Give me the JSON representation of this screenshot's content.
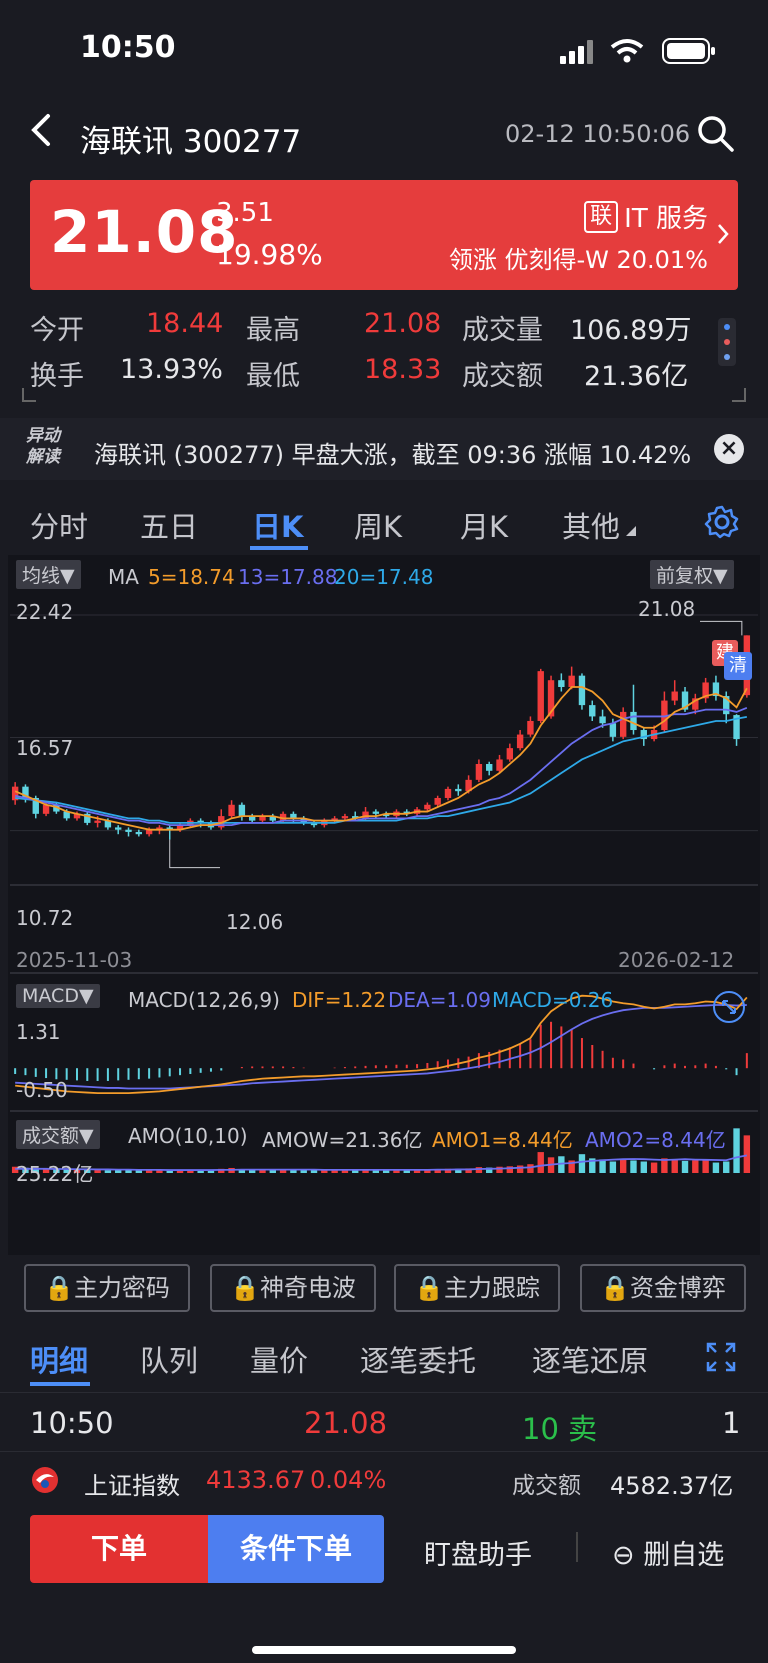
{
  "status": {
    "time": "10:50"
  },
  "header": {
    "title": "海联讯 300277",
    "datetime": "02-12 10:50:06"
  },
  "quote": {
    "price": "21.08",
    "change": "3.51",
    "change_pct": "19.98%",
    "sector_tag": "联",
    "sector": "IT 服务",
    "leader": "领涨 优刻得-W 20.01%"
  },
  "stats": {
    "open_label": "今开",
    "open": "18.44",
    "high_label": "最高",
    "high": "21.08",
    "vol_label": "成交量",
    "vol": "106.89万",
    "turnover_label": "换手",
    "turnover": "13.93%",
    "low_label": "最低",
    "low": "18.33",
    "amt_label": "成交额",
    "amt": "21.36亿"
  },
  "news": {
    "badge_line1": "异动",
    "badge_line2": "解读",
    "text": "海联讯 (300277) 早盘大涨，截至 09:36 涨幅 10.42%",
    "close": "×"
  },
  "tabs": [
    "分时",
    "五日",
    "日K",
    "周K",
    "月K",
    "其他"
  ],
  "chart": {
    "ma_pill": "均线▼",
    "ma_label": "MA",
    "ma5": "5=18.74",
    "ma13": "13=17.88",
    "ma20": "20=17.48",
    "adj_pill": "前复权▼",
    "y_top": "22.42",
    "y_mid": "16.57",
    "y_low": "10.72",
    "high_mark": "21.08",
    "low_mark": "12.06",
    "badge_build": "建",
    "badge_clear": "清",
    "date_start": "2025-11-03",
    "date_end": "2026-02-12",
    "macd_pill": "MACD▼",
    "macd_label": "MACD(12,26,9)",
    "dif": "DIF=1.22",
    "dea": "DEA=1.09",
    "macd": "MACD=0.26",
    "macd_top": "1.31",
    "macd_bottom": "-0.50",
    "amo_pill": "成交额▼",
    "amo_label": "AMO(10,10)",
    "amow": "AMOW=21.36亿",
    "amo1": "AMO1=8.44亿",
    "amo2": "AMO2=8.44亿",
    "amo_top": "25.22亿"
  },
  "func_buttons": [
    "主力密码",
    "神奇电波",
    "主力跟踪",
    "资金博弈"
  ],
  "bottom_tabs": [
    "明细",
    "队列",
    "量价",
    "逐笔委托",
    "逐笔还原"
  ],
  "trade": {
    "time": "10:50",
    "price": "21.08",
    "side": "10 卖",
    "count": "1"
  },
  "index": {
    "name": "上证指数",
    "value": "4133.67",
    "pct": "0.04%",
    "amt_label": "成交额",
    "amt": "4582.37亿"
  },
  "actions": {
    "order": "下单",
    "cond_order": "条件下单",
    "watch": "盯盘助手",
    "remove": "删自选",
    "remove_icon": "⊖"
  },
  "colors": {
    "up": "#f03b3b",
    "down": "#5fd3e0",
    "accent": "#4d8ef7",
    "ma5": "#f39c2b",
    "ma13": "#6a6ef0",
    "ma20": "#2ea9e8"
  },
  "chart_data": {
    "type": "candlestick",
    "ylim": [
      10.72,
      22.42
    ],
    "candles": [
      [
        13.8,
        14.4,
        14.6,
        13.6
      ],
      [
        14.4,
        13.9,
        14.5,
        13.7
      ],
      [
        13.9,
        13.2,
        14.0,
        13.0
      ],
      [
        13.2,
        13.6,
        13.7,
        13.1
      ],
      [
        13.6,
        13.3,
        13.7,
        13.2
      ],
      [
        13.3,
        13.0,
        13.4,
        12.9
      ],
      [
        13.0,
        13.2,
        13.3,
        12.9
      ],
      [
        13.2,
        12.8,
        13.3,
        12.7
      ],
      [
        12.8,
        12.9,
        13.1,
        12.6
      ],
      [
        12.9,
        12.6,
        13.0,
        12.5
      ],
      [
        12.6,
        12.5,
        12.7,
        12.3
      ],
      [
        12.5,
        12.4,
        12.6,
        12.2
      ],
      [
        12.4,
        12.3,
        12.5,
        12.2
      ],
      [
        12.3,
        12.5,
        12.6,
        12.2
      ],
      [
        12.5,
        12.6,
        12.7,
        12.3
      ],
      [
        12.6,
        12.5,
        12.7,
        12.06
      ],
      [
        12.5,
        12.7,
        12.8,
        12.4
      ],
      [
        12.7,
        12.9,
        13.0,
        12.6
      ],
      [
        12.9,
        12.8,
        13.0,
        12.6
      ],
      [
        12.8,
        12.6,
        12.9,
        12.5
      ],
      [
        12.6,
        13.1,
        13.4,
        12.5
      ],
      [
        13.1,
        13.6,
        13.8,
        13.0
      ],
      [
        13.6,
        13.1,
        13.7,
        12.9
      ],
      [
        13.1,
        12.9,
        13.2,
        12.8
      ],
      [
        12.9,
        13.1,
        13.2,
        12.8
      ],
      [
        13.1,
        12.9,
        13.2,
        12.8
      ],
      [
        12.9,
        13.2,
        13.3,
        12.8
      ],
      [
        13.2,
        13.0,
        13.3,
        12.8
      ],
      [
        13.0,
        12.8,
        13.1,
        12.7
      ],
      [
        12.8,
        12.7,
        12.9,
        12.6
      ],
      [
        12.7,
        12.9,
        13.0,
        12.6
      ],
      [
        12.9,
        13.0,
        13.1,
        12.8
      ],
      [
        13.0,
        13.1,
        13.2,
        12.9
      ],
      [
        13.1,
        13.0,
        13.3,
        12.9
      ],
      [
        13.0,
        13.3,
        13.5,
        12.9
      ],
      [
        13.3,
        13.2,
        13.4,
        13.0
      ],
      [
        13.2,
        13.1,
        13.3,
        13.0
      ],
      [
        13.1,
        13.3,
        13.4,
        13.0
      ],
      [
        13.3,
        13.2,
        13.4,
        13.1
      ],
      [
        13.2,
        13.4,
        13.5,
        13.1
      ],
      [
        13.4,
        13.6,
        13.7,
        13.3
      ],
      [
        13.6,
        13.9,
        14.0,
        13.5
      ],
      [
        13.9,
        14.3,
        14.4,
        13.8
      ],
      [
        14.3,
        14.2,
        14.5,
        14.0
      ],
      [
        14.2,
        14.7,
        14.9,
        14.1
      ],
      [
        14.7,
        15.4,
        15.6,
        14.6
      ],
      [
        15.4,
        15.1,
        15.5,
        14.9
      ],
      [
        15.1,
        15.6,
        15.8,
        15.0
      ],
      [
        15.6,
        16.1,
        16.3,
        15.5
      ],
      [
        16.1,
        16.7,
        16.9,
        16.0
      ],
      [
        16.7,
        17.3,
        17.5,
        16.6
      ],
      [
        17.3,
        19.5,
        19.6,
        17.2
      ],
      [
        17.5,
        19.1,
        19.3,
        17.4
      ],
      [
        19.1,
        18.8,
        19.4,
        18.6
      ],
      [
        18.8,
        19.3,
        19.7,
        18.7
      ],
      [
        19.3,
        18.0,
        19.4,
        17.8
      ],
      [
        18.0,
        17.5,
        18.2,
        17.3
      ],
      [
        17.5,
        17.2,
        17.8,
        17.0
      ],
      [
        17.2,
        16.6,
        17.4,
        16.4
      ],
      [
        16.6,
        17.7,
        17.9,
        16.5
      ],
      [
        17.7,
        16.9,
        18.9,
        16.7
      ],
      [
        16.9,
        16.5,
        17.0,
        16.2
      ],
      [
        16.5,
        16.9,
        17.1,
        16.4
      ],
      [
        16.9,
        18.2,
        18.6,
        16.8
      ],
      [
        18.2,
        18.6,
        19.1,
        18.0
      ],
      [
        18.6,
        17.8,
        18.8,
        17.7
      ],
      [
        17.8,
        18.3,
        18.5,
        17.6
      ],
      [
        18.3,
        19.0,
        19.2,
        18.1
      ],
      [
        19.0,
        18.4,
        19.3,
        18.2
      ],
      [
        18.4,
        17.6,
        18.6,
        17.2
      ],
      [
        17.56,
        16.5,
        17.6,
        16.2
      ],
      [
        18.44,
        21.08,
        21.08,
        18.33
      ]
    ],
    "ma5": [
      14.2,
      14.0,
      13.8,
      13.6,
      13.5,
      13.3,
      13.2,
      13.1,
      13.0,
      12.9,
      12.8,
      12.7,
      12.6,
      12.5,
      12.5,
      12.5,
      12.5,
      12.6,
      12.7,
      12.7,
      12.8,
      13.0,
      13.1,
      13.1,
      13.1,
      13.1,
      13.0,
      13.0,
      13.0,
      12.9,
      12.9,
      12.9,
      12.9,
      13.0,
      13.1,
      13.1,
      13.2,
      13.2,
      13.2,
      13.3,
      13.3,
      13.5,
      13.7,
      13.9,
      14.2,
      14.5,
      14.7,
      15.0,
      15.4,
      15.8,
      16.3,
      17.1,
      17.7,
      18.3,
      18.8,
      18.8,
      18.6,
      18.2,
      17.6,
      17.4,
      17.2,
      17.0,
      17.0,
      17.3,
      17.7,
      17.9,
      18.2,
      18.4,
      18.5,
      18.3,
      17.9,
      18.74
    ],
    "ma13": [
      14.0,
      13.9,
      13.8,
      13.7,
      13.6,
      13.5,
      13.4,
      13.3,
      13.2,
      13.1,
      13.0,
      12.9,
      12.9,
      12.8,
      12.8,
      12.7,
      12.7,
      12.7,
      12.7,
      12.7,
      12.7,
      12.7,
      12.8,
      12.8,
      12.8,
      12.8,
      12.9,
      12.9,
      12.9,
      12.9,
      12.9,
      12.9,
      12.9,
      12.9,
      13.0,
      13.0,
      13.0,
      13.0,
      13.0,
      13.1,
      13.1,
      13.2,
      13.3,
      13.4,
      13.5,
      13.6,
      13.8,
      13.9,
      14.1,
      14.4,
      14.7,
      15.1,
      15.5,
      15.9,
      16.3,
      16.6,
      16.9,
      17.1,
      17.2,
      17.4,
      17.5,
      17.5,
      17.5,
      17.5,
      17.6,
      17.6,
      17.7,
      17.8,
      17.8,
      17.8,
      17.7,
      17.88
    ],
    "ma20": [
      13.9,
      13.85,
      13.8,
      13.75,
      13.7,
      13.6,
      13.5,
      13.4,
      13.3,
      13.2,
      13.1,
      13.0,
      13.0,
      12.9,
      12.9,
      12.8,
      12.8,
      12.8,
      12.8,
      12.8,
      12.8,
      12.8,
      12.8,
      12.8,
      12.8,
      12.8,
      12.8,
      12.8,
      12.8,
      12.8,
      12.8,
      12.8,
      12.9,
      12.9,
      12.9,
      12.9,
      12.9,
      12.9,
      13.0,
      13.0,
      13.0,
      13.1,
      13.1,
      13.2,
      13.3,
      13.4,
      13.5,
      13.6,
      13.7,
      13.9,
      14.1,
      14.4,
      14.7,
      15.0,
      15.3,
      15.6,
      15.8,
      16.0,
      16.2,
      16.4,
      16.5,
      16.6,
      16.7,
      16.8,
      16.9,
      17.0,
      17.1,
      17.2,
      17.3,
      17.3,
      17.4,
      17.48
    ],
    "macd": [
      -0.1,
      -0.12,
      -0.15,
      -0.17,
      -0.19,
      -0.2,
      -0.21,
      -0.22,
      -0.22,
      -0.22,
      -0.21,
      -0.2,
      -0.19,
      -0.18,
      -0.16,
      -0.14,
      -0.12,
      -0.1,
      -0.08,
      -0.06,
      -0.04,
      0.0,
      0.02,
      0.03,
      0.03,
      0.03,
      0.03,
      0.02,
      0.01,
      0.0,
      0.0,
      0.01,
      0.02,
      0.03,
      0.04,
      0.05,
      0.05,
      0.06,
      0.06,
      0.07,
      0.09,
      0.12,
      0.15,
      0.17,
      0.2,
      0.26,
      0.28,
      0.32,
      0.36,
      0.42,
      0.5,
      0.75,
      0.8,
      0.72,
      0.66,
      0.52,
      0.4,
      0.3,
      0.18,
      0.15,
      0.08,
      0.0,
      -0.02,
      0.05,
      0.08,
      0.04,
      0.05,
      0.08,
      0.04,
      -0.02,
      -0.12,
      0.26
    ],
    "dif": [
      -0.3,
      -0.32,
      -0.34,
      -0.36,
      -0.38,
      -0.4,
      -0.41,
      -0.42,
      -0.43,
      -0.43,
      -0.43,
      -0.43,
      -0.42,
      -0.41,
      -0.4,
      -0.38,
      -0.36,
      -0.34,
      -0.32,
      -0.3,
      -0.28,
      -0.25,
      -0.22,
      -0.2,
      -0.18,
      -0.17,
      -0.16,
      -0.15,
      -0.14,
      -0.14,
      -0.13,
      -0.12,
      -0.11,
      -0.1,
      -0.09,
      -0.08,
      -0.07,
      -0.06,
      -0.05,
      -0.04,
      -0.02,
      0.0,
      0.04,
      0.08,
      0.12,
      0.18,
      0.22,
      0.28,
      0.34,
      0.42,
      0.52,
      0.78,
      0.98,
      1.1,
      1.2,
      1.25,
      1.24,
      1.2,
      1.15,
      1.12,
      1.1,
      1.06,
      1.03,
      1.06,
      1.1,
      1.1,
      1.12,
      1.15,
      1.14,
      1.1,
      1.02,
      1.22
    ],
    "dea": [
      -0.25,
      -0.26,
      -0.27,
      -0.28,
      -0.29,
      -0.3,
      -0.31,
      -0.32,
      -0.33,
      -0.34,
      -0.34,
      -0.35,
      -0.35,
      -0.35,
      -0.35,
      -0.35,
      -0.34,
      -0.33,
      -0.32,
      -0.31,
      -0.3,
      -0.29,
      -0.28,
      -0.26,
      -0.25,
      -0.24,
      -0.23,
      -0.22,
      -0.21,
      -0.2,
      -0.19,
      -0.18,
      -0.17,
      -0.16,
      -0.15,
      -0.14,
      -0.13,
      -0.12,
      -0.11,
      -0.1,
      -0.09,
      -0.07,
      -0.05,
      -0.03,
      0.0,
      0.03,
      0.07,
      0.11,
      0.16,
      0.21,
      0.27,
      0.35,
      0.45,
      0.56,
      0.67,
      0.77,
      0.85,
      0.91,
      0.96,
      1.0,
      1.02,
      1.04,
      1.04,
      1.04,
      1.05,
      1.06,
      1.07,
      1.08,
      1.09,
      1.09,
      1.08,
      1.09
    ],
    "amo": [
      3.0,
      2.5,
      2.2,
      2.0,
      1.8,
      1.6,
      1.5,
      1.5,
      1.4,
      1.3,
      1.3,
      1.3,
      1.2,
      1.2,
      1.4,
      1.5,
      1.4,
      1.5,
      1.5,
      1.4,
      2.0,
      2.4,
      1.8,
      1.6,
      1.5,
      1.5,
      1.6,
      1.5,
      1.4,
      1.3,
      1.4,
      1.4,
      1.5,
      1.4,
      1.6,
      1.5,
      1.4,
      1.5,
      1.4,
      1.6,
      1.7,
      1.8,
      2.0,
      2.0,
      2.2,
      2.8,
      2.6,
      3.0,
      3.2,
      3.6,
      4.2,
      10.0,
      7.5,
      8.0,
      6.0,
      9.0,
      7.0,
      6.5,
      5.5,
      6.5,
      6.0,
      5.5,
      5.0,
      7.0,
      6.5,
      5.8,
      6.0,
      6.5,
      5.0,
      5.5,
      21.36,
      18.0
    ],
    "amo_ma": [
      2.0,
      2.0,
      2.0,
      2.0,
      1.9,
      1.9,
      1.8,
      1.8,
      1.7,
      1.7,
      1.6,
      1.6,
      1.5,
      1.5,
      1.5,
      1.4,
      1.4,
      1.4,
      1.4,
      1.4,
      1.5,
      1.5,
      1.6,
      1.6,
      1.6,
      1.6,
      1.6,
      1.6,
      1.6,
      1.6,
      1.5,
      1.5,
      1.5,
      1.5,
      1.5,
      1.5,
      1.5,
      1.5,
      1.5,
      1.5,
      1.5,
      1.6,
      1.6,
      1.7,
      1.7,
      1.9,
      2.0,
      2.1,
      2.3,
      2.5,
      2.7,
      3.5,
      4.0,
      4.5,
      4.8,
      5.4,
      5.8,
      6.1,
      6.4,
      6.6,
      6.7,
      6.6,
      6.4,
      6.2,
      6.4,
      6.6,
      6.4,
      6.3,
      6.2,
      6.1,
      7.5,
      8.44
    ]
  }
}
